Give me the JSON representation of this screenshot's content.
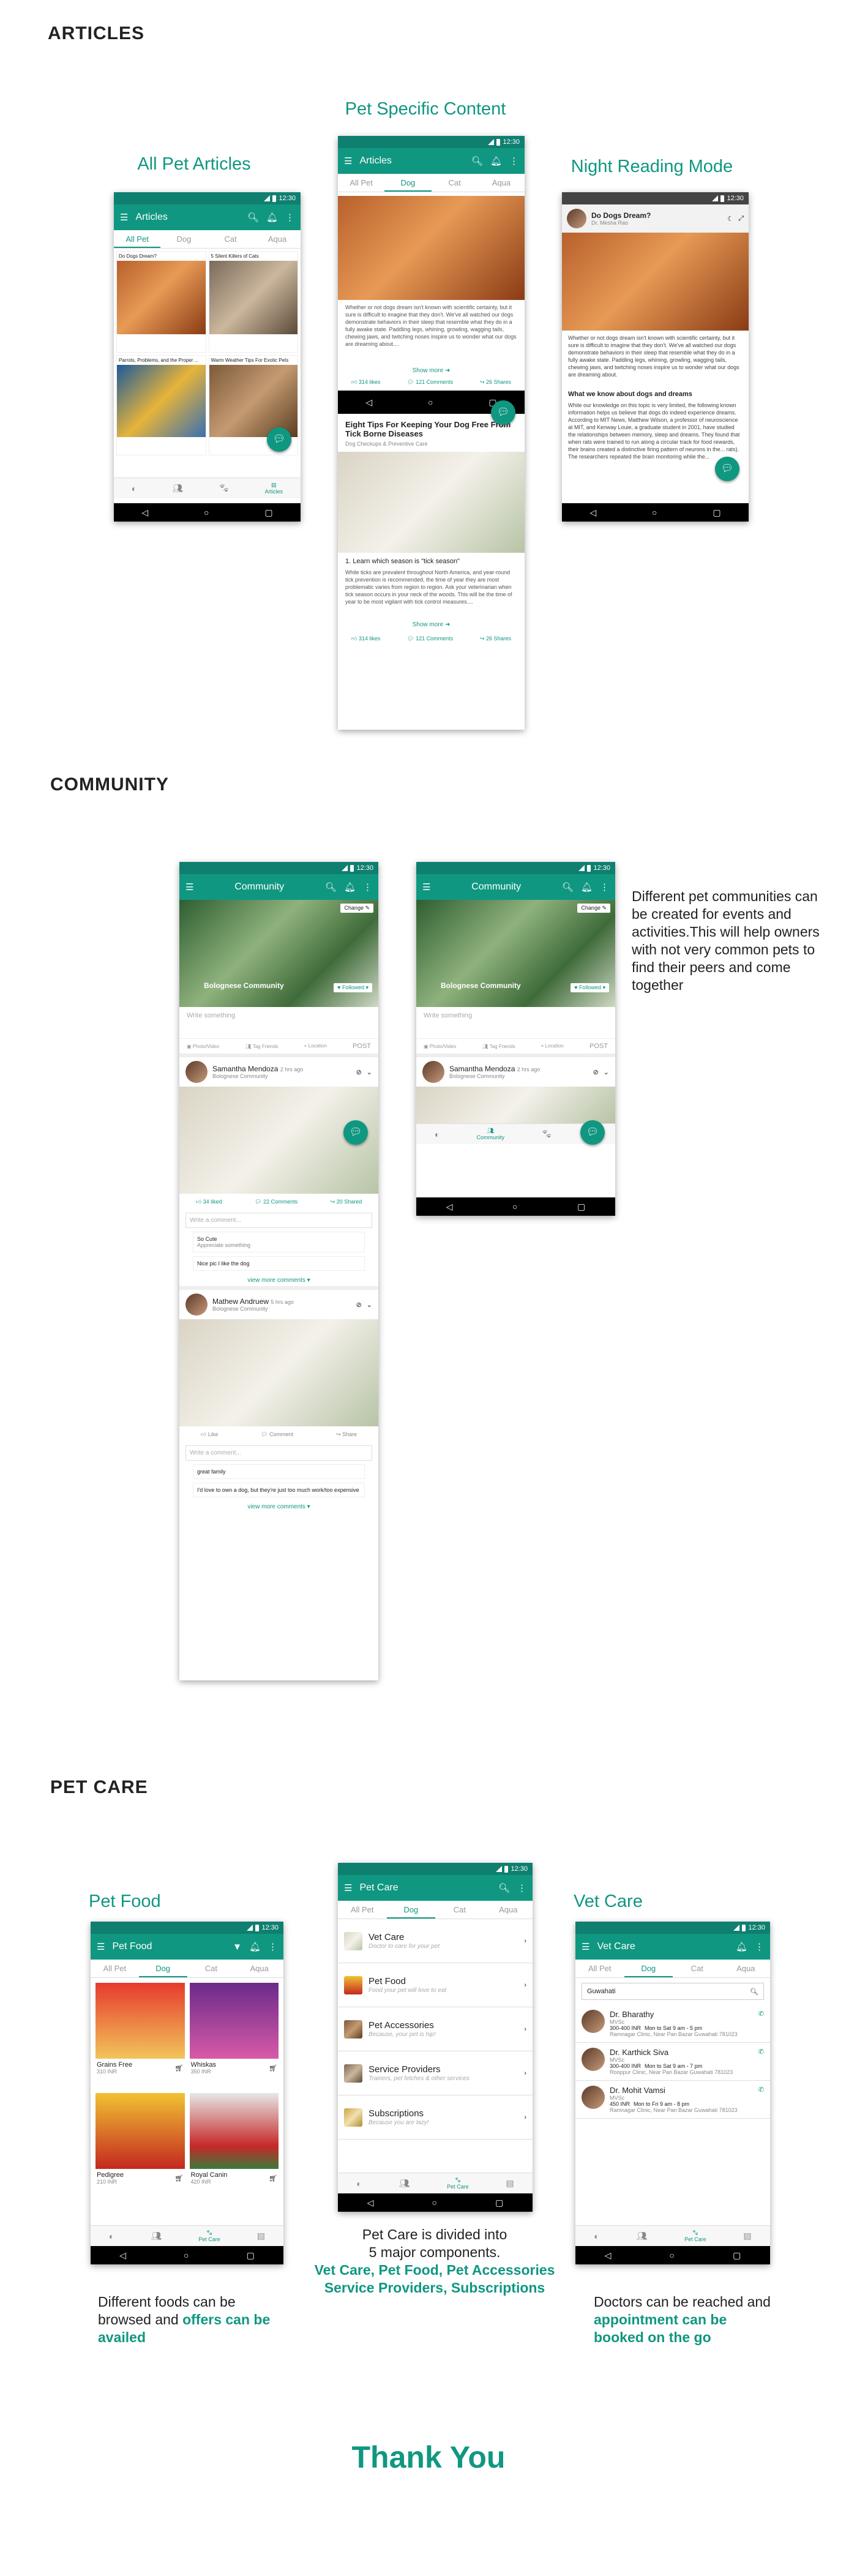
{
  "sections": {
    "articles": "ARTICLES",
    "community": "COMMUNITY",
    "petcare": "PET CARE"
  },
  "captions": {
    "all_pet_articles": "All Pet Articles",
    "pet_specific": "Pet Specific Content",
    "night_mode": "Night Reading Mode",
    "pet_food": "Pet Food",
    "vet_care": "Vet Care"
  },
  "status_time": "12:30",
  "articles_screen": {
    "title": "Articles",
    "tabs": [
      "All Pet",
      "Dog",
      "Cat",
      "Aqua"
    ],
    "bottom_active": "Articles",
    "cards": [
      {
        "title": "Do Dogs Dream?"
      },
      {
        "title": "5 Silent Killers of Cats"
      },
      {
        "title": "Parrots, Problems, and the Proper ..."
      },
      {
        "title": "Warm Weather Tips For Exotic Pets"
      }
    ]
  },
  "dog_article": {
    "title": "Articles",
    "body1": "Whether or not dogs dream isn't known with scientific certainty, but it sure is difficult to imagine that they don't. We've all watched our dogs demonstrate behaviors in their sleep that resemble what they do in a fully awake state. Paddling legs, whining, growling, wagging tails, chewing jaws, and twitching noses inspire us to wonder what our dogs are dreaming about....",
    "show_more": "Show more",
    "likes": "314 likes",
    "comments": "121 Comments",
    "shares": "26 Shares",
    "title2": "Eight Tips For Keeping Your Dog Free From Tick Borne Diseases",
    "sub2": "Dog Checkups & Preventive Care",
    "point2": "1. Learn which season is \"tick season\"",
    "body2": "While ticks are prevalent throughout North America, and year-round tick prevention is recommended, the time of year they are most problematic varies from region to region. Ask your veterinarian when tick season occurs in your neck of the woods. This will be the time of year to be most vigilant with tick control measures...."
  },
  "night": {
    "title": "Do Dogs Dream?",
    "author": "Dr. Mesha Rao",
    "body": "Whether or not dogs dream isn't known with scientific certainty, but it sure is difficult to imagine that they don't. We've all watched our dogs demonstrate behaviors in their sleep that resemble what they do in a fully awake state. Paddling legs, whining, growling, wagging tails, chewing jaws, and twitching noses inspire us to wonder what our dogs are dreaming about.",
    "heading": "What we know about dogs and dreams",
    "body2": "While our knowledge on this topic is very limited, the following known information helps us believe that dogs do indeed experience dreams. According to MIT News, Matthew Wilson, a professor of neuroscience at MIT, and Kenway Louie, a graduate student in 2001, have studied the relationships between memory, sleep and dreams. They found that when rats were trained to run along a circular track for food rewards, their brains created a distinctive firing pattern of neurons in the... rats). The researchers repeated the brain monitoring while the..."
  },
  "community": {
    "title": "Community",
    "change": "Change",
    "group": "Bolognese Community",
    "followed": "Followed",
    "write": "Write something",
    "actions": [
      "Photo/Video",
      "Tag Friends",
      "Location"
    ],
    "post": "POST",
    "bottom_active": "Community",
    "posts": [
      {
        "name": "Samantha Mendoza",
        "time": "2 hrs ago",
        "group": "Bolognese Community",
        "likes": "34 liked",
        "comments": "22 Comments",
        "shares": "20 Shared",
        "comment_placeholder": "Write a comment...",
        "comments_list": [
          {
            "name": "So Cute",
            "text": "Appreciate something"
          },
          {
            "name": "Nice pic I like the dog",
            "text": ""
          }
        ],
        "view_more": "view more comments"
      },
      {
        "name": "Mathew Andruew",
        "time": "5 hrs ago",
        "group": "Bolognese Community",
        "likes": "Like",
        "comments": "Comment",
        "shares": "Share",
        "comment_placeholder": "Write a comment...",
        "comments_list": [
          {
            "name": "great family",
            "text": ""
          },
          {
            "name": "I'd love to own a dog, but they're just too much work/too expensive",
            "text": ""
          }
        ],
        "view_more": "view more comments"
      }
    ],
    "description": "Different pet communities can be created for events and activities.This will help owners with not very common pets to find their peers and come together"
  },
  "petcare": {
    "title": "Pet Care",
    "tabs": [
      "All Pet",
      "Dog",
      "Cat",
      "Aqua"
    ],
    "items": [
      {
        "name": "Vet Care",
        "sub": "Doctor to care for your pet"
      },
      {
        "name": "Pet Food",
        "sub": "Food your pet will love to eat"
      },
      {
        "name": "Pet Accessories",
        "sub": "Because, your pet is hip!"
      },
      {
        "name": "Service Providers",
        "sub": "Trainers, pet fetches & other services"
      },
      {
        "name": "Subscriptions",
        "sub": "Because you are lazy!"
      }
    ],
    "bottom_active": "Pet Care",
    "desc_line1": "Pet Care is divided into",
    "desc_line2": "5 major components.",
    "desc_hl1": "Vet Care, Pet Food, Pet Accessories",
    "desc_hl2": "Service Providers, Subscriptions"
  },
  "petfood": {
    "title": "Pet Food",
    "tabs": [
      "All Pet",
      "Dog",
      "Cat",
      "Aqua"
    ],
    "items": [
      {
        "name": "Grains Free",
        "price": "310 INR"
      },
      {
        "name": "Whiskas",
        "price": "350 INR"
      },
      {
        "name": "Pedigree",
        "price": "210 INR"
      },
      {
        "name": "Royal Canin",
        "price": "420 INR"
      }
    ],
    "bottom_active": "Pet Care",
    "desc_a": "Different foods can be browsed and ",
    "desc_hl": "offers can be availed"
  },
  "vetcare": {
    "title": "Vet Care",
    "tabs": [
      "All Pet",
      "Dog",
      "Cat",
      "Aqua"
    ],
    "location": "Guwahati",
    "doctors": [
      {
        "name": "Dr. Bharathy",
        "deg": "MVSc",
        "fee": "300-400 INR",
        "time": "Mon to Sat 9 am - 5 pm",
        "addr": "Ramnagar Clinic, Near Pan Bazar Guwahati 781023"
      },
      {
        "name": "Dr. Karthick Siva",
        "deg": "MVSc",
        "fee": "300-400 INR",
        "time": "Mon to Sat 9 am - 7 pm",
        "addr": "Rooppur Clinic, Near Pan Bazar Guwahati 781023"
      },
      {
        "name": "Dr. Mohit Vamsi",
        "deg": "MVSc",
        "fee": "450 INR",
        "time": "Mon to Fri 9 am - 8 pm",
        "addr": "Ramnagar Clinic, Near Pan Bazar Guwahati 781023"
      }
    ],
    "bottom_active": "Pet Care",
    "desc_a": "Doctors can be reached and ",
    "desc_hl": "appointment can be booked on the go"
  },
  "thankyou": "Thank You",
  "colors": {
    "accent": "#109781",
    "dark": "#0f7f70"
  }
}
